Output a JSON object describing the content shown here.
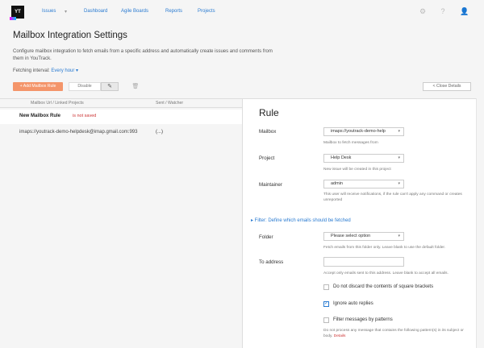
{
  "header": {
    "logo": "YT",
    "nav": [
      {
        "label": "Issues"
      },
      {
        "label": "▾"
      },
      {
        "label": "Dashboard"
      },
      {
        "label": "Agile Boards"
      },
      {
        "label": "Reports"
      },
      {
        "label": "Projects"
      }
    ],
    "icons": [
      "gear-icon",
      "help-icon",
      "user-icon"
    ]
  },
  "page": {
    "title": "Mailbox Integration Settings",
    "description": "Configure mailbox integration to fetch emails from a specific address and automatically create issues and comments from them in YouTrack.",
    "interval_label": "Fetching interval:",
    "interval_value": "Every hour ▾"
  },
  "toolbar": {
    "add_label": "+ Add Mailbox Rule",
    "disable_label": "Disable",
    "edit_icon": "pencil-icon",
    "delete_icon": "trash-icon",
    "close_label": "< Close Details"
  },
  "table": {
    "headers": [
      "Mailbox Url / Linked Projects",
      "Sent / Watcher"
    ],
    "rows": [
      {
        "name": "New Mailbox Rule",
        "status": "is not saved"
      },
      {
        "name": "imaps://youtrack-demo-helpdesk@imap.gmail.com:993",
        "status": "(...)"
      }
    ]
  },
  "rule": {
    "title": "Rule",
    "mailbox_label": "Mailbox",
    "mailbox_value": "imaps://youtrack-demo-help",
    "mailbox_hint": "Mailbox to fetch messages from",
    "project_label": "Project",
    "project_value": "Help Desk",
    "project_hint": "New issue will be created in this project",
    "maintainer_label": "Maintainer",
    "maintainer_value": "admin",
    "maintainer_hint": "This user will receive notifications, if the rule can't apply any command or creates unreported",
    "filter_link": "▸ Filter: Define which emails should be fetched",
    "folder_label": "Folder",
    "folder_value": "Please select option",
    "folder_hint": "Fetch emails from this folder only. Leave blank to use the default folder.",
    "to_label": "To address",
    "to_value": "",
    "to_hint": "Accept only emails sent to this address. Leave blank to accept all emails.",
    "chk1_label": "Do not discard the contents of square brackets",
    "chk2_label": "Ignore auto replies",
    "chk3_label": "Filter messages by patterns",
    "chk3_hint": "Do not process any message that contains the following pattern(s) in its subject or body.",
    "chk3_hint_tag": "Details"
  }
}
